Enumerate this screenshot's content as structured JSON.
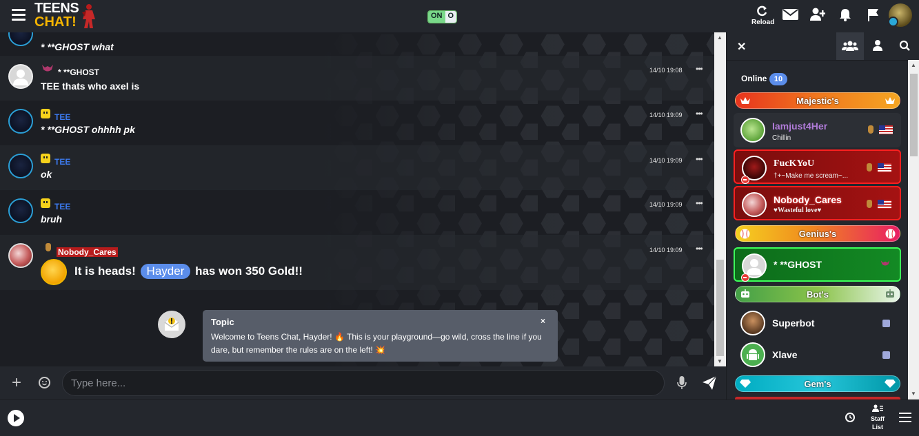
{
  "app": {
    "logo_line1": "TEENS",
    "logo_line2": "CHAT!",
    "toggle_on": "ON",
    "toggle_off": "O"
  },
  "header": {
    "reload_label": "Reload",
    "icons": [
      "reload-icon",
      "mail-icon",
      "add-friend-icon",
      "bell-icon",
      "flag-icon"
    ]
  },
  "messages": [
    {
      "name": "",
      "text": "* **GHOST what",
      "time": ""
    },
    {
      "name": "* **GHOST",
      "text": "TEE thats who axel is",
      "time": "14/10 19:08"
    },
    {
      "name": "TEE",
      "text": "* **GHOST ohhhh pk",
      "time": "14/10 19:09"
    },
    {
      "name": "TEE",
      "text": "ok",
      "time": "14/10 19:09"
    },
    {
      "name": "TEE",
      "text": "bruh",
      "time": "14/10 19:09"
    },
    {
      "name": "Nobody_Cares",
      "text_before": "It is heads!",
      "mention": "Hayder",
      "text_after": "has won 350 Gold!!",
      "time": "14/10 19:09"
    }
  ],
  "topic": {
    "title": "Topic",
    "body": "Welcome to Teens Chat, Hayder! 🔥 This is your playground—go wild, cross the line if you dare, but remember the rules are on the left! 💥",
    "close": "×"
  },
  "input": {
    "placeholder": "Type here...",
    "plus": "+"
  },
  "footer": {
    "staff_label_1": "Staff",
    "staff_label_2": "List"
  },
  "panel": {
    "close": "✕",
    "online_label": "Online",
    "online_count": "10",
    "ranks": [
      {
        "label": "Majestic's",
        "color": "#e5431d"
      },
      {
        "label": "Genius's",
        "color": "#e91e63"
      },
      {
        "label": "Bot's",
        "color": "#66bb6a"
      },
      {
        "label": "Gem's",
        "color": "#26c6da"
      }
    ],
    "users": [
      {
        "name": "Iamjust4Her",
        "status": "Chillin",
        "color": "#b07bd8"
      },
      {
        "name": "FucKYoU",
        "status": "†+~Make me scream~...",
        "color": "#ffffff"
      },
      {
        "name": "Nobody_Cares",
        "status": "♥Wasteful love♥",
        "color": "#ffffff"
      },
      {
        "name": "* **GHOST",
        "status": "",
        "color": "#ffffff"
      },
      {
        "name": "Superbot",
        "status": "",
        "color": "#ffffff"
      },
      {
        "name": "Xlave",
        "status": "",
        "color": "#ffffff"
      }
    ]
  }
}
